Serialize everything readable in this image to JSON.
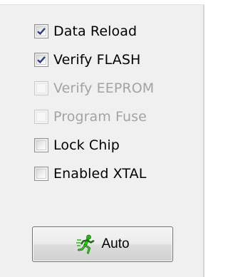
{
  "options": [
    {
      "label": "Data Reload",
      "checked": true,
      "enabled": true
    },
    {
      "label": "Verify FLASH",
      "checked": true,
      "enabled": true
    },
    {
      "label": "Verify EEPROM",
      "checked": false,
      "enabled": false
    },
    {
      "label": "Program Fuse",
      "checked": false,
      "enabled": false
    },
    {
      "label": "Lock Chip",
      "checked": false,
      "enabled": true
    },
    {
      "label": "Enabled XTAL",
      "checked": false,
      "enabled": true
    }
  ],
  "auto_button": {
    "label": "Auto",
    "icon": "running-man-icon"
  },
  "colors": {
    "panel_bg": "#f0f0f0",
    "check_mark": "#2b3f80",
    "disabled_text": "#a3a3a3",
    "icon_green": "#2fb51e"
  }
}
